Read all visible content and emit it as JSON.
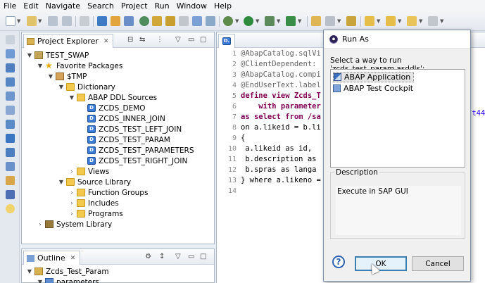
{
  "menu": [
    "File",
    "Edit",
    "Navigate",
    "Search",
    "Project",
    "Run",
    "Window",
    "Help"
  ],
  "project_explorer": {
    "tab_label": "Project Explorer",
    "tree": [
      {
        "label": "TEST_SWAP",
        "icon": "project-icon",
        "level": 0,
        "arrow": "expanded"
      },
      {
        "label": "Favorite Packages",
        "icon": "star-icon",
        "level": 1,
        "arrow": "expanded"
      },
      {
        "label": "$TMP",
        "icon": "package-icon",
        "level": 2,
        "arrow": "expanded"
      },
      {
        "label": "Dictionary",
        "icon": "folder-icon",
        "level": 3,
        "arrow": "expanded"
      },
      {
        "label": "ABAP DDL Sources",
        "icon": "folder-icon",
        "level": 4,
        "arrow": "expanded"
      },
      {
        "label": "ZCDS_DEMO",
        "icon": "ddl-source-icon",
        "level": 5,
        "arrow": "none"
      },
      {
        "label": "ZCDS_INNER_JOIN",
        "icon": "ddl-source-icon",
        "level": 5,
        "arrow": "none"
      },
      {
        "label": "ZCDS_TEST_LEFT_JOIN",
        "icon": "ddl-source-icon",
        "level": 5,
        "arrow": "none"
      },
      {
        "label": "ZCDS_TEST_PARAM",
        "icon": "ddl-source-icon",
        "level": 5,
        "arrow": "none"
      },
      {
        "label": "ZCDS_TEST_PARAMETERS",
        "icon": "ddl-source-icon",
        "level": 5,
        "arrow": "none"
      },
      {
        "label": "ZCDS_TEST_RIGHT_JOIN",
        "icon": "ddl-source-icon",
        "level": 5,
        "arrow": "none"
      },
      {
        "label": "Views",
        "icon": "folder-icon",
        "level": 4,
        "arrow": "collapsed"
      },
      {
        "label": "Source Library",
        "icon": "folder-icon",
        "level": 3,
        "arrow": "expanded"
      },
      {
        "label": "Function Groups",
        "icon": "folder-icon",
        "level": 4,
        "arrow": "collapsed"
      },
      {
        "label": "Includes",
        "icon": "folder-icon",
        "level": 4,
        "arrow": "collapsed"
      },
      {
        "label": "Programs",
        "icon": "folder-icon",
        "level": 4,
        "arrow": "collapsed"
      },
      {
        "label": "System Library",
        "icon": "library-icon",
        "level": 1,
        "arrow": "collapsed"
      }
    ]
  },
  "outline": {
    "tab_label": "Outline",
    "tree": [
      {
        "label": "Zcds_Test_Param",
        "icon": "view-icon",
        "level": 0,
        "arrow": "expanded"
      },
      {
        "label": "parameters",
        "icon": "parameter-icon",
        "level": 1,
        "arrow": "expanded"
      }
    ]
  },
  "editor": {
    "tab_label": "D.",
    "lines": [
      {
        "n": "1",
        "text": "@AbapCatalog.sqlVi",
        "cls": "an"
      },
      {
        "n": "2",
        "text": "@ClientDependent: ",
        "cls": "an"
      },
      {
        "n": "3",
        "text": "@AbapCatalog.compi",
        "cls": "an"
      },
      {
        "n": "4",
        "text": "@EndUserText.label",
        "cls": "an"
      },
      {
        "n": "5",
        "text": "define view Zcds_T",
        "cls": "kw"
      },
      {
        "n": "6",
        "text": "    with parameter",
        "cls": "kw"
      },
      {
        "n": "7",
        "text": "as select from /sa",
        "cls": "kw"
      },
      {
        "n": "8",
        "text": "on a.likeid = b.li",
        "cls": ""
      },
      {
        "n": "9",
        "text": "{",
        "cls": ""
      },
      {
        "n": "10",
        "text": " a.likeid as id,",
        "cls": ""
      },
      {
        "n": "11",
        "text": " b.description as",
        "cls": ""
      },
      {
        "n": "12",
        "text": " b.spras as langa",
        "cls": ""
      },
      {
        "n": "13",
        "text": "} where a.likeno =",
        "cls": ""
      },
      {
        "n": "14",
        "text": "",
        "cls": ""
      }
    ],
    "overflow_fragment": "/t44"
  },
  "dialog": {
    "title": "Run As",
    "prompt": "Select a way to run 'zcds_test_param.asddls':",
    "options": [
      {
        "label": "ABAP Application",
        "icon": "abap-application-icon",
        "selected": true
      },
      {
        "label": "ABAP Test Cockpit",
        "icon": "abap-test-cockpit-icon",
        "selected": false
      }
    ],
    "description_label": "Description",
    "description_text": "Execute in SAP GUI",
    "help_label": "?",
    "ok_label": "OK",
    "cancel_label": "Cancel"
  }
}
